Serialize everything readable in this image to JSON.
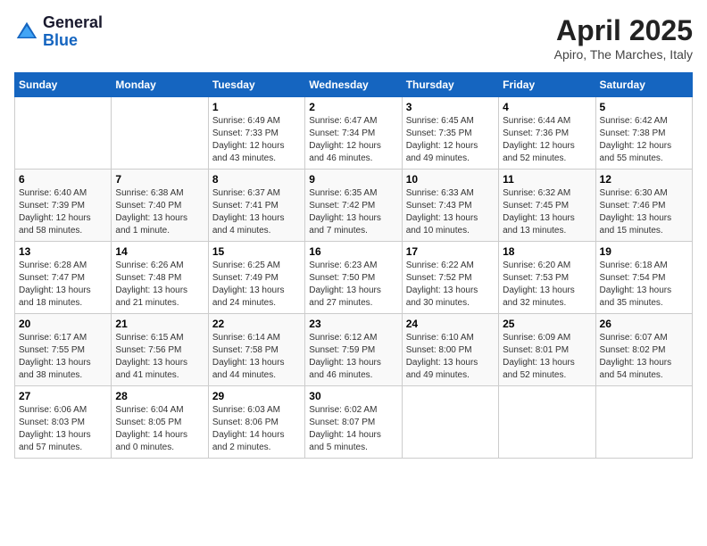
{
  "header": {
    "logo_line1": "General",
    "logo_line2": "Blue",
    "month_year": "April 2025",
    "location": "Apiro, The Marches, Italy"
  },
  "days_of_week": [
    "Sunday",
    "Monday",
    "Tuesday",
    "Wednesday",
    "Thursday",
    "Friday",
    "Saturday"
  ],
  "weeks": [
    [
      {
        "day": "",
        "sunrise": "",
        "sunset": "",
        "daylight": ""
      },
      {
        "day": "",
        "sunrise": "",
        "sunset": "",
        "daylight": ""
      },
      {
        "day": "1",
        "sunrise": "Sunrise: 6:49 AM",
        "sunset": "Sunset: 7:33 PM",
        "daylight": "Daylight: 12 hours and 43 minutes."
      },
      {
        "day": "2",
        "sunrise": "Sunrise: 6:47 AM",
        "sunset": "Sunset: 7:34 PM",
        "daylight": "Daylight: 12 hours and 46 minutes."
      },
      {
        "day": "3",
        "sunrise": "Sunrise: 6:45 AM",
        "sunset": "Sunset: 7:35 PM",
        "daylight": "Daylight: 12 hours and 49 minutes."
      },
      {
        "day": "4",
        "sunrise": "Sunrise: 6:44 AM",
        "sunset": "Sunset: 7:36 PM",
        "daylight": "Daylight: 12 hours and 52 minutes."
      },
      {
        "day": "5",
        "sunrise": "Sunrise: 6:42 AM",
        "sunset": "Sunset: 7:38 PM",
        "daylight": "Daylight: 12 hours and 55 minutes."
      }
    ],
    [
      {
        "day": "6",
        "sunrise": "Sunrise: 6:40 AM",
        "sunset": "Sunset: 7:39 PM",
        "daylight": "Daylight: 12 hours and 58 minutes."
      },
      {
        "day": "7",
        "sunrise": "Sunrise: 6:38 AM",
        "sunset": "Sunset: 7:40 PM",
        "daylight": "Daylight: 13 hours and 1 minute."
      },
      {
        "day": "8",
        "sunrise": "Sunrise: 6:37 AM",
        "sunset": "Sunset: 7:41 PM",
        "daylight": "Daylight: 13 hours and 4 minutes."
      },
      {
        "day": "9",
        "sunrise": "Sunrise: 6:35 AM",
        "sunset": "Sunset: 7:42 PM",
        "daylight": "Daylight: 13 hours and 7 minutes."
      },
      {
        "day": "10",
        "sunrise": "Sunrise: 6:33 AM",
        "sunset": "Sunset: 7:43 PM",
        "daylight": "Daylight: 13 hours and 10 minutes."
      },
      {
        "day": "11",
        "sunrise": "Sunrise: 6:32 AM",
        "sunset": "Sunset: 7:45 PM",
        "daylight": "Daylight: 13 hours and 13 minutes."
      },
      {
        "day": "12",
        "sunrise": "Sunrise: 6:30 AM",
        "sunset": "Sunset: 7:46 PM",
        "daylight": "Daylight: 13 hours and 15 minutes."
      }
    ],
    [
      {
        "day": "13",
        "sunrise": "Sunrise: 6:28 AM",
        "sunset": "Sunset: 7:47 PM",
        "daylight": "Daylight: 13 hours and 18 minutes."
      },
      {
        "day": "14",
        "sunrise": "Sunrise: 6:26 AM",
        "sunset": "Sunset: 7:48 PM",
        "daylight": "Daylight: 13 hours and 21 minutes."
      },
      {
        "day": "15",
        "sunrise": "Sunrise: 6:25 AM",
        "sunset": "Sunset: 7:49 PM",
        "daylight": "Daylight: 13 hours and 24 minutes."
      },
      {
        "day": "16",
        "sunrise": "Sunrise: 6:23 AM",
        "sunset": "Sunset: 7:50 PM",
        "daylight": "Daylight: 13 hours and 27 minutes."
      },
      {
        "day": "17",
        "sunrise": "Sunrise: 6:22 AM",
        "sunset": "Sunset: 7:52 PM",
        "daylight": "Daylight: 13 hours and 30 minutes."
      },
      {
        "day": "18",
        "sunrise": "Sunrise: 6:20 AM",
        "sunset": "Sunset: 7:53 PM",
        "daylight": "Daylight: 13 hours and 32 minutes."
      },
      {
        "day": "19",
        "sunrise": "Sunrise: 6:18 AM",
        "sunset": "Sunset: 7:54 PM",
        "daylight": "Daylight: 13 hours and 35 minutes."
      }
    ],
    [
      {
        "day": "20",
        "sunrise": "Sunrise: 6:17 AM",
        "sunset": "Sunset: 7:55 PM",
        "daylight": "Daylight: 13 hours and 38 minutes."
      },
      {
        "day": "21",
        "sunrise": "Sunrise: 6:15 AM",
        "sunset": "Sunset: 7:56 PM",
        "daylight": "Daylight: 13 hours and 41 minutes."
      },
      {
        "day": "22",
        "sunrise": "Sunrise: 6:14 AM",
        "sunset": "Sunset: 7:58 PM",
        "daylight": "Daylight: 13 hours and 44 minutes."
      },
      {
        "day": "23",
        "sunrise": "Sunrise: 6:12 AM",
        "sunset": "Sunset: 7:59 PM",
        "daylight": "Daylight: 13 hours and 46 minutes."
      },
      {
        "day": "24",
        "sunrise": "Sunrise: 6:10 AM",
        "sunset": "Sunset: 8:00 PM",
        "daylight": "Daylight: 13 hours and 49 minutes."
      },
      {
        "day": "25",
        "sunrise": "Sunrise: 6:09 AM",
        "sunset": "Sunset: 8:01 PM",
        "daylight": "Daylight: 13 hours and 52 minutes."
      },
      {
        "day": "26",
        "sunrise": "Sunrise: 6:07 AM",
        "sunset": "Sunset: 8:02 PM",
        "daylight": "Daylight: 13 hours and 54 minutes."
      }
    ],
    [
      {
        "day": "27",
        "sunrise": "Sunrise: 6:06 AM",
        "sunset": "Sunset: 8:03 PM",
        "daylight": "Daylight: 13 hours and 57 minutes."
      },
      {
        "day": "28",
        "sunrise": "Sunrise: 6:04 AM",
        "sunset": "Sunset: 8:05 PM",
        "daylight": "Daylight: 14 hours and 0 minutes."
      },
      {
        "day": "29",
        "sunrise": "Sunrise: 6:03 AM",
        "sunset": "Sunset: 8:06 PM",
        "daylight": "Daylight: 14 hours and 2 minutes."
      },
      {
        "day": "30",
        "sunrise": "Sunrise: 6:02 AM",
        "sunset": "Sunset: 8:07 PM",
        "daylight": "Daylight: 14 hours and 5 minutes."
      },
      {
        "day": "",
        "sunrise": "",
        "sunset": "",
        "daylight": ""
      },
      {
        "day": "",
        "sunrise": "",
        "sunset": "",
        "daylight": ""
      },
      {
        "day": "",
        "sunrise": "",
        "sunset": "",
        "daylight": ""
      }
    ]
  ]
}
